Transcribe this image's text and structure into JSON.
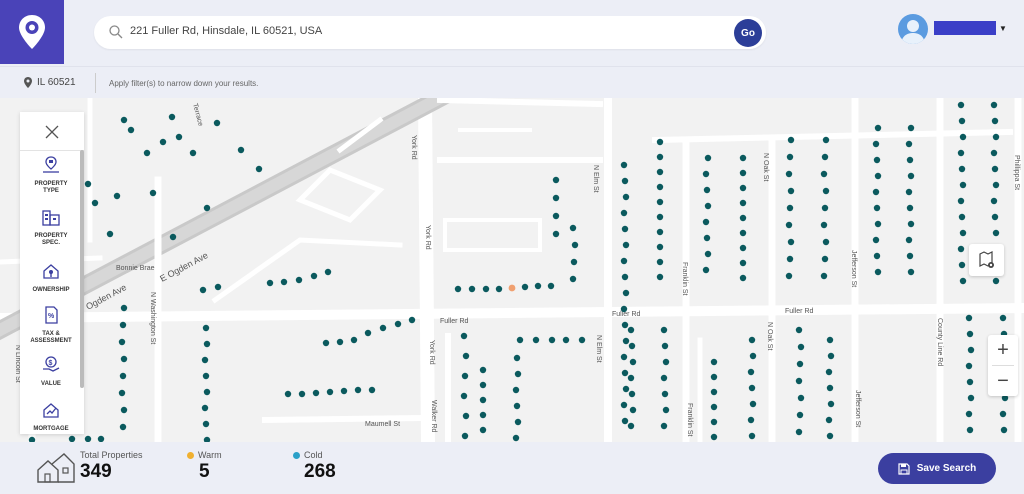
{
  "header": {
    "search_value": "221 Fuller Rd, Hinsdale, IL 60521, USA",
    "go_label": "Go",
    "user_name_color": "#3b3fc7"
  },
  "filterbar": {
    "zip": "IL 60521",
    "hint": "Apply filter(s) to narrow down your results."
  },
  "sidebar": {
    "items": [
      {
        "label_1": "PROPERTY",
        "label_2": "TYPE",
        "icon": "property-type-icon"
      },
      {
        "label_1": "PROPERTY",
        "label_2": "SPEC.",
        "icon": "property-spec-icon"
      },
      {
        "label_1": "OWNERSHIP",
        "label_2": "",
        "icon": "ownership-icon"
      },
      {
        "label_1": "TAX &",
        "label_2": "ASSESSMENT",
        "icon": "tax-icon"
      },
      {
        "label_1": "VALUE",
        "label_2": "",
        "icon": "value-icon"
      },
      {
        "label_1": "MORTGAGE",
        "label_2": "",
        "icon": "mortgage-icon"
      }
    ]
  },
  "map": {
    "streets": [
      "York Rd",
      "York Rd",
      "York Rd",
      "Ogden Ave",
      "E Ogden Ave",
      "Bonnie Brae",
      "N Washington St",
      "N Lincoln St",
      "Fuller Rd",
      "Fuller Rd",
      "Fuller Rd",
      "Maumell St",
      "Walker Rd",
      "N Elm St",
      "N Elm St",
      "Franklin St",
      "Franklin St",
      "N Oak St",
      "N Oak St",
      "Jefferson St",
      "Jefferson St",
      "County Line Rd",
      "Phillippa St",
      "Terrace",
      "N Elm St"
    ],
    "colors": {
      "cold": "#0b5a5e",
      "warm": "#f0a070"
    }
  },
  "footer": {
    "total_label": "Total Properties",
    "total_value": "349",
    "warm_label": "Warm",
    "warm_value": "5",
    "warm_color": "#f0b030",
    "cold_label": "Cold",
    "cold_value": "268",
    "cold_color": "#2aa0c8",
    "save_label": "Save Search"
  }
}
